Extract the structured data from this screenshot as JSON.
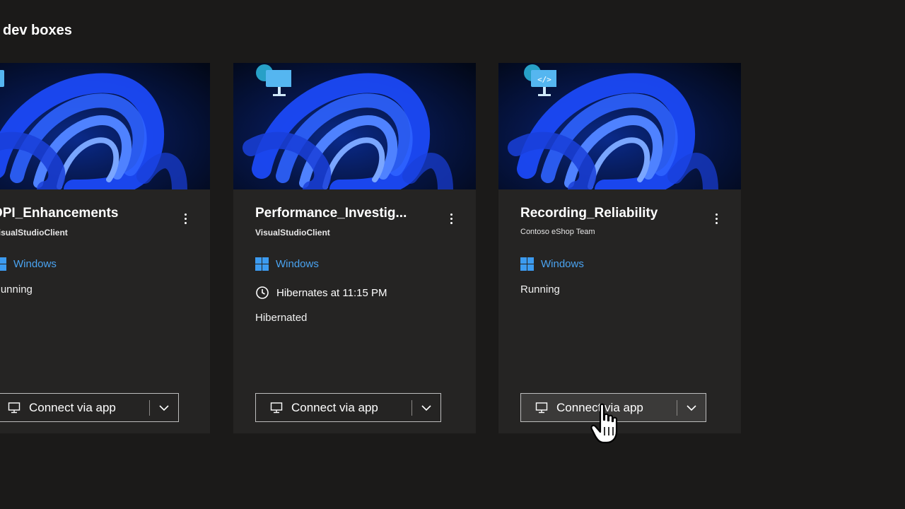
{
  "section": {
    "title": "dev boxes"
  },
  "cards": [
    {
      "name": "DPI_Enhancements",
      "project": "VisualStudioClient",
      "os": "Windows",
      "schedule": "",
      "status": "Running",
      "connect_label": "Connect via app"
    },
    {
      "name": "Performance_Investig...",
      "project": "VisualStudioClient",
      "os": "Windows",
      "schedule": "Hibernates at 11:15 PM",
      "status": "Hibernated",
      "connect_label": "Connect via app"
    },
    {
      "name": "Recording_Reliability",
      "project": "Contoso eShop Team",
      "os": "Windows",
      "schedule": "",
      "status": "Running",
      "connect_label": "Connect via app"
    }
  ],
  "colors": {
    "background": "#1b1a19",
    "card": "#252423",
    "link": "#4aa3f0"
  },
  "icons": [
    "windows-logo-icon",
    "clock-icon",
    "monitor-icon",
    "chevron-down-icon",
    "more-options-icon",
    "hand-cursor-icon"
  ]
}
